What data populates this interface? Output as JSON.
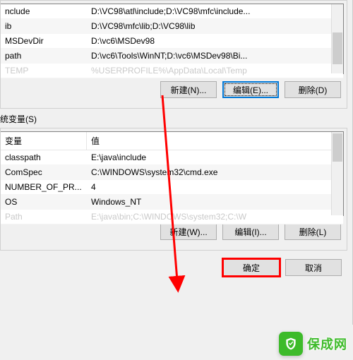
{
  "user_vars_table": {
    "rows": [
      {
        "name": "nclude",
        "value": "D:\\VC98\\atl\\include;D:\\VC98\\mfc\\include..."
      },
      {
        "name": "ib",
        "value": "D:\\VC98\\mfc\\lib;D:\\VC98\\lib"
      },
      {
        "name": "MSDevDir",
        "value": "D:\\vc6\\MSDev98"
      },
      {
        "name": "path",
        "value": "D:\\vc6\\Tools\\WinNT;D:\\vc6\\MSDev98\\Bi..."
      },
      {
        "name": "TEMP",
        "value": "%USERPROFILE%\\AppData\\Local\\Temp",
        "faded": true
      }
    ]
  },
  "user_buttons": {
    "new": "新建(N)...",
    "edit": "编辑(E)...",
    "delete": "删除(D)"
  },
  "system_section_label": "统变量(S)",
  "system_vars_table": {
    "headers": {
      "name": "变量",
      "value": "值"
    },
    "rows": [
      {
        "name": "classpath",
        "value": "E:\\java\\include"
      },
      {
        "name": "ComSpec",
        "value": "C:\\WINDOWS\\system32\\cmd.exe"
      },
      {
        "name": "NUMBER_OF_PR...",
        "value": "4"
      },
      {
        "name": "OS",
        "value": "Windows_NT"
      },
      {
        "name": "Path",
        "value": "E:\\java\\bin;C:\\WINDOWS\\system32;C:\\W",
        "faded": true
      }
    ]
  },
  "system_buttons": {
    "new": "新建(W)...",
    "edit": "编辑(I)...",
    "delete": "删除(L)"
  },
  "dialog_buttons": {
    "ok": "确定",
    "cancel": "取消"
  },
  "watermark": {
    "text": "保成网",
    "icon": "shield-icon"
  },
  "colors": {
    "accent": "#0078d7",
    "highlight": "#ff0000",
    "brand": "#3dbb2a"
  }
}
